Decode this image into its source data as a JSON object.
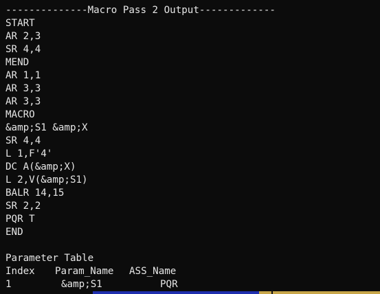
{
  "terminal": {
    "header": "--------------Macro Pass 2 Output-------------",
    "lines": [
      "START",
      "AR 2,3",
      "SR 4,4",
      "MEND",
      "AR 1,1",
      "AR 3,3",
      "AR 3,3",
      "MACRO",
      "&amp;S1 &amp;X",
      "SR 4,4",
      "L 1,F'4'",
      "DC A(&amp;X)",
      "L 2,V(&amp;S1)",
      "BALR 14,15",
      "SR 2,2",
      "PQR T",
      "END"
    ],
    "parameter_table": {
      "title": "Parameter Table",
      "headers": [
        "Index",
        "Param_Name",
        "ASS_Name"
      ],
      "rows": [
        [
          "1",
          "&amp;S1",
          "PQR"
        ]
      ]
    }
  },
  "colors": {
    "background": "#0c0c0c",
    "text": "#e6e6e6",
    "taskbar_blue": "#1f2fae",
    "taskbar_gold": "#c8a64a"
  }
}
